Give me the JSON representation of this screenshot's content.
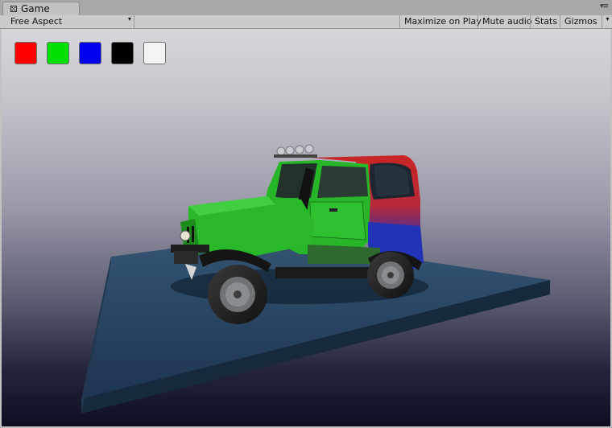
{
  "tab": {
    "title": "Game",
    "icon": "unity-game-icon"
  },
  "toolbar": {
    "aspect": "Free Aspect",
    "maximize": "Maximize on Play",
    "mute": "Mute audio",
    "stats": "Stats",
    "gizmos": "Gizmos"
  },
  "swatches": [
    {
      "name": "red",
      "color": "#ff0000"
    },
    {
      "name": "green",
      "color": "#00e000"
    },
    {
      "name": "blue",
      "color": "#0000ee"
    },
    {
      "name": "black",
      "color": "#000000"
    },
    {
      "name": "white",
      "color": "#f4f4f4"
    }
  ],
  "colors": {
    "platform_top": "#2c4864",
    "jeep_green": "#22b522",
    "jeep_red": "#c82525",
    "jeep_blue": "#1f2fb7"
  }
}
